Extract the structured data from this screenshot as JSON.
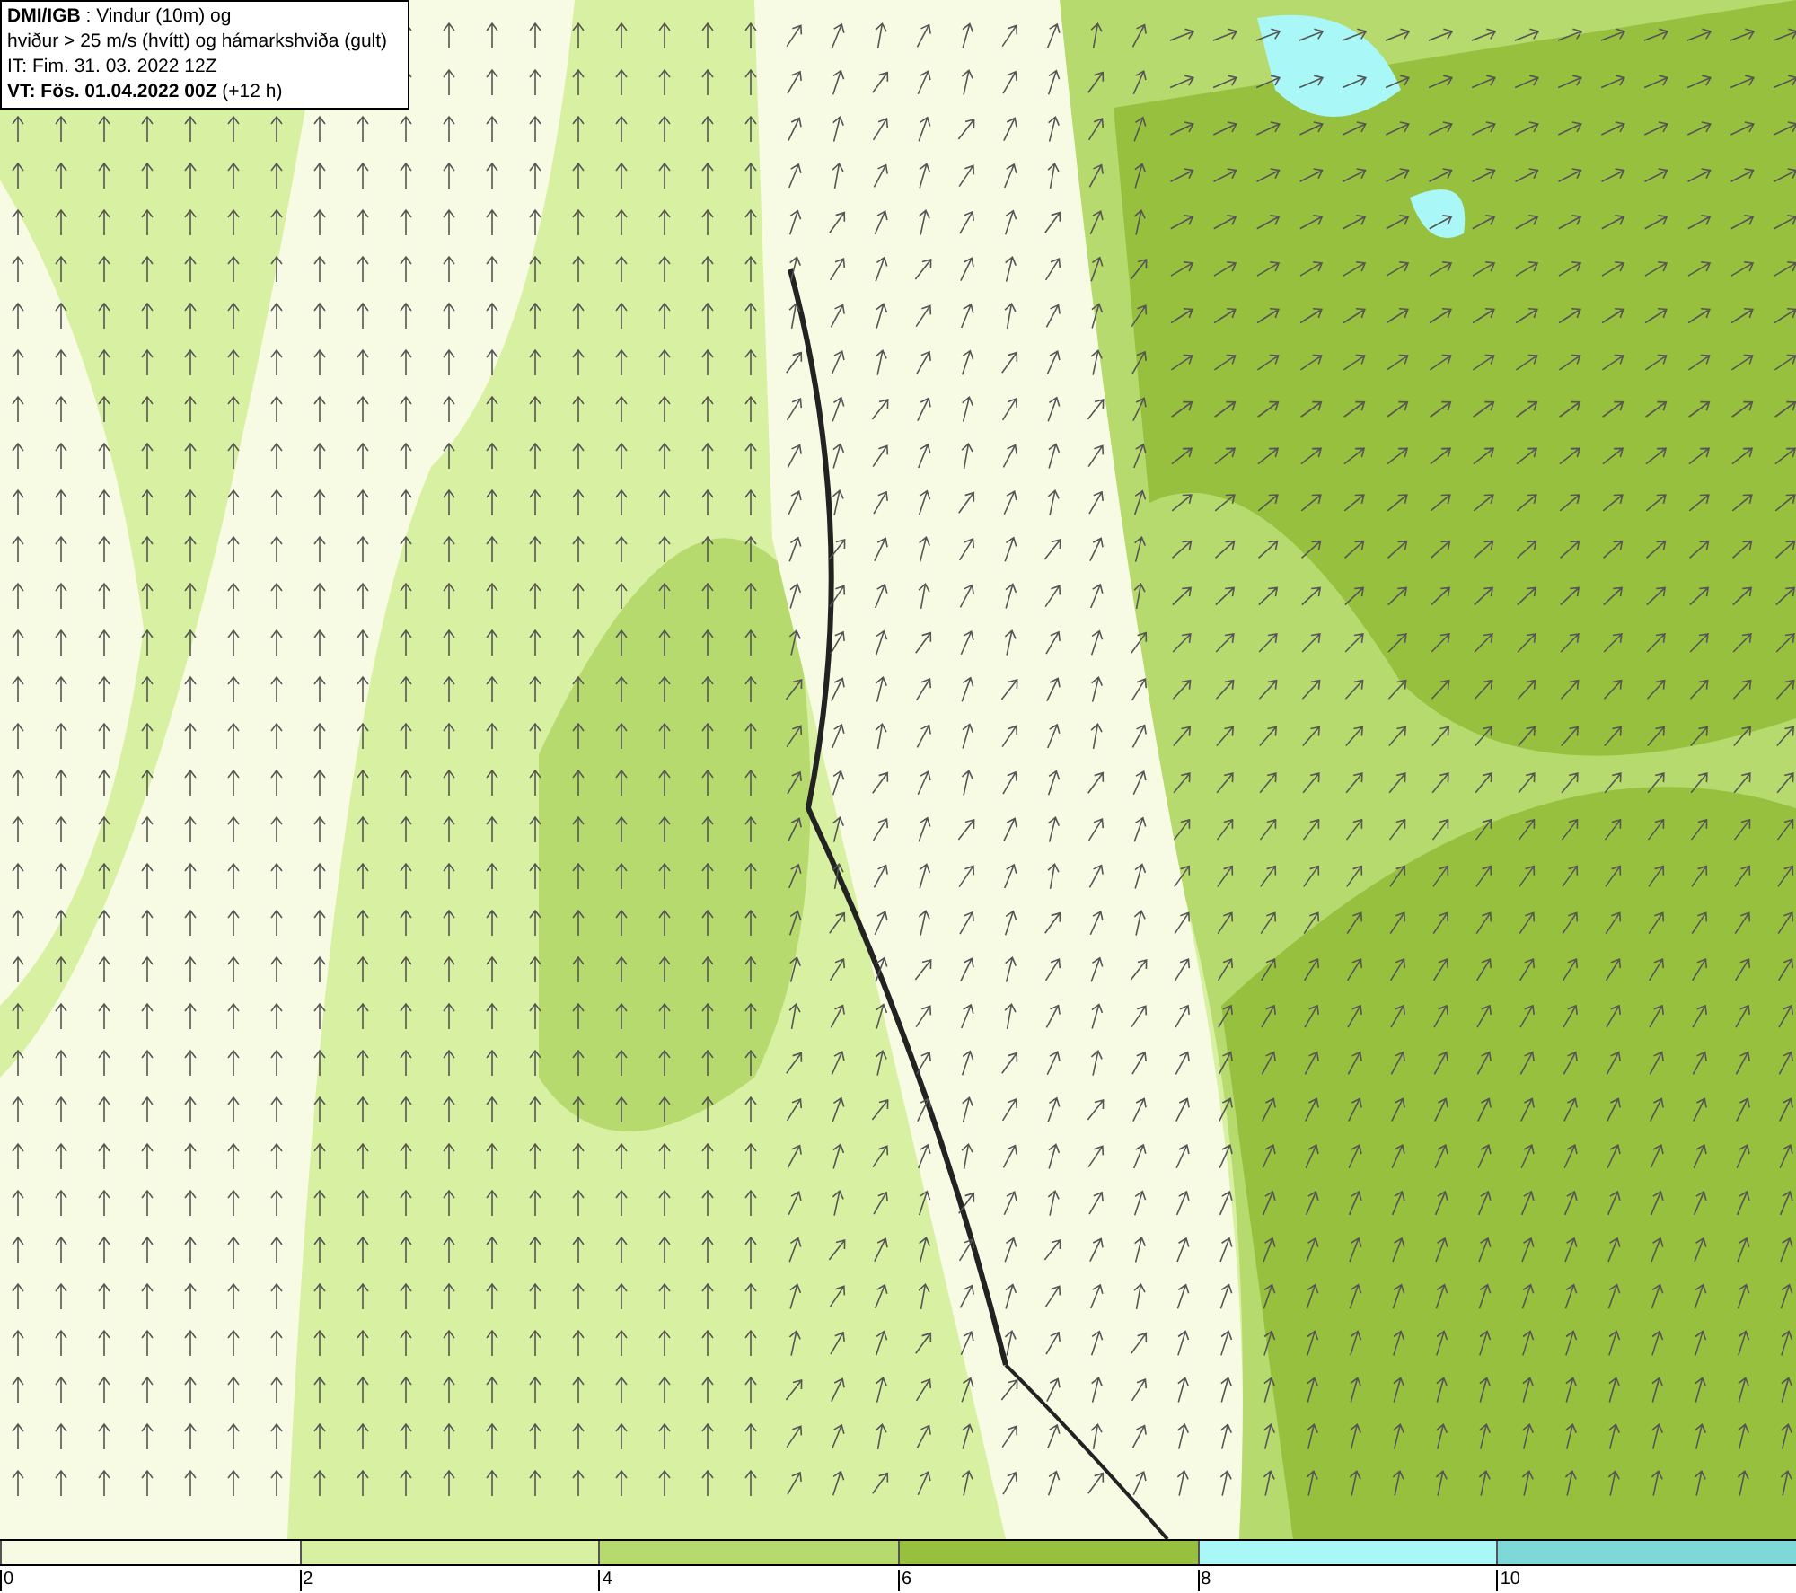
{
  "info_box": {
    "lines": [
      "**DMI/IGB** : Vindur (10m) og",
      "hviður > 25 m/s (hvítt) og hámarkshviða (gult)",
      "IT: Fim. 31. 03. 2022 12Z",
      "**VT: Fös. 01.04.2022 00Z** (+12 h)"
    ]
  },
  "legend": {
    "bins": [
      {
        "color": "#f7fbe3"
      },
      {
        "color": "#d8f0a2"
      },
      {
        "color": "#b6da6e"
      },
      {
        "color": "#97c03f"
      },
      {
        "color": "#a9f7f7"
      },
      {
        "color": "#7fd8d8"
      }
    ],
    "ticks": [
      "0",
      "2",
      "4",
      "6",
      "8",
      "10"
    ]
  }
}
